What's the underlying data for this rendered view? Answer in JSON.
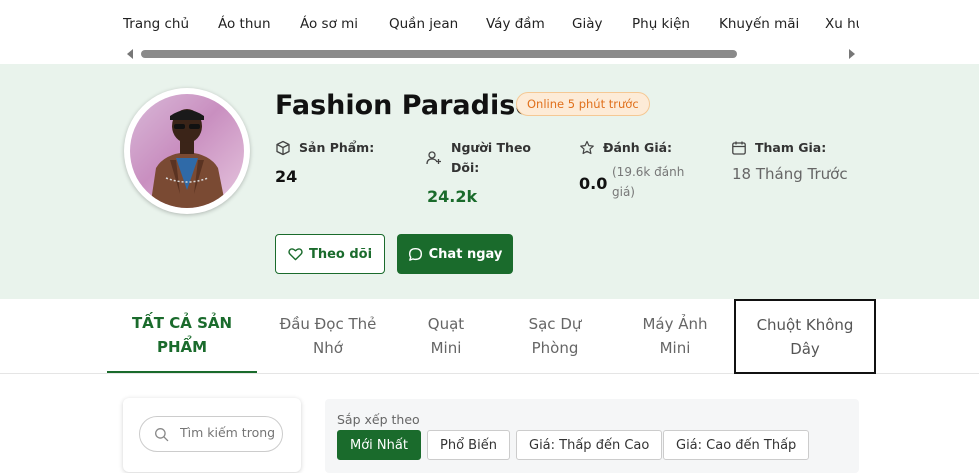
{
  "nav": {
    "items": [
      "Trang chủ",
      "Áo thun",
      "Áo sơ mi",
      "Quần jean",
      "Váy đầm",
      "Giày",
      "Phụ kiện",
      "Khuyến mãi",
      "Xu hướng"
    ]
  },
  "shop": {
    "name": "Fashion Paradise",
    "online_status": "Online 5 phút trước",
    "stats": {
      "products": {
        "label": "Sản Phẩm:",
        "value": "24"
      },
      "followers": {
        "label": "Người Theo Dõi:",
        "value": "24.2k"
      },
      "rating": {
        "label": "Đánh Giá:",
        "value": "0.0",
        "sub": "(19.6k đánh giá)"
      },
      "joined": {
        "label": "Tham Gia:",
        "value": "18 Tháng Trước"
      }
    },
    "follow_label": "Theo dõi",
    "chat_label": "Chat ngay"
  },
  "tabs": [
    "TẤT CẢ SẢN PHẨM",
    "Đầu Đọc Thẻ Nhớ",
    "Quạt Mini",
    "Sạc Dự Phòng",
    "Máy Ảnh Mini",
    "Chuột Không Dây"
  ],
  "search": {
    "placeholder": "Tìm kiếm trong shop"
  },
  "sort": {
    "label": "Sắp xếp theo",
    "options": [
      "Mới Nhất",
      "Phổ Biến",
      "Giá: Thấp đến Cao",
      "Giá: Cao đến Thấp"
    ]
  },
  "colors": {
    "brand": "#1a6b2c",
    "header_bg": "#e9f3ec",
    "online": "#e0701c"
  }
}
